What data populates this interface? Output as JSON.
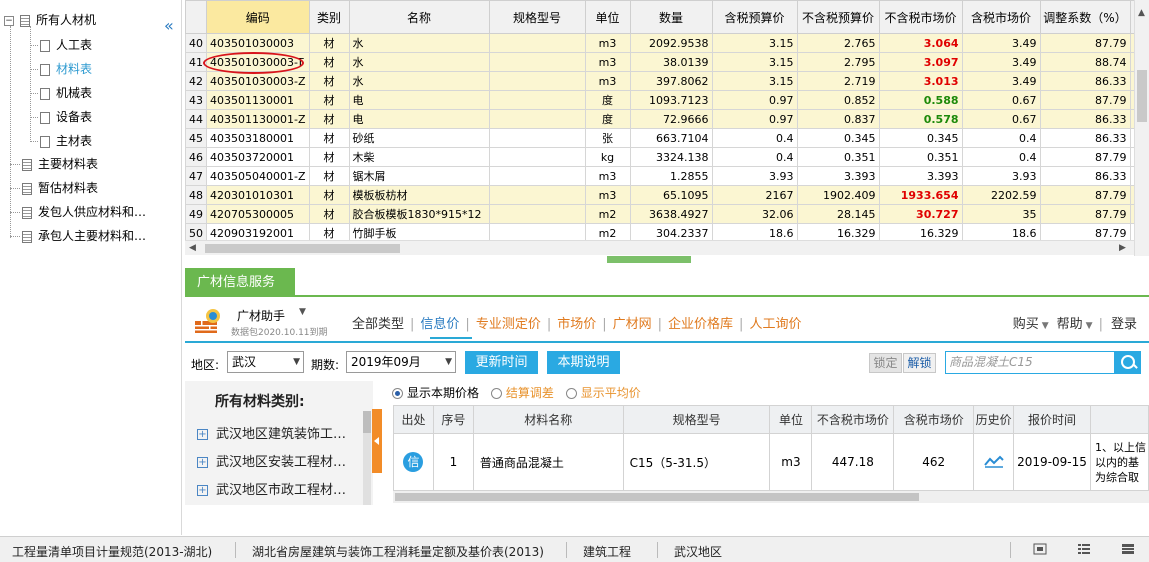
{
  "sidebar": {
    "collapse_icon": "«",
    "root_label": "所有人材机",
    "children": [
      "人工表",
      "材料表",
      "机械表",
      "设备表",
      "主材表"
    ],
    "selected": "材料表",
    "others": [
      "主要材料表",
      "暂估材料表",
      "发包人供应材料和…",
      "承包人主要材料和…"
    ]
  },
  "grid": {
    "columns": [
      "",
      "编码",
      "类别",
      "名称",
      "规格型号",
      "单位",
      "数量",
      "含税预算价",
      "不含税预算价",
      "不含税市场价",
      "含税市场价",
      "调整系数（%）"
    ],
    "rows": [
      {
        "no": "40",
        "code": "403501030003",
        "cat": "材",
        "name": "水",
        "spec": "",
        "unit": "m3",
        "qty": "2092.9538",
        "tax_budget": "3.15",
        "notax_budget": "2.765",
        "notax_market": "3.064",
        "market_style": "red",
        "tax_market": "3.49",
        "adj": "87.79",
        "hl": true
      },
      {
        "no": "41",
        "code": "403501030003-T",
        "cat": "材",
        "name": "水",
        "spec": "",
        "unit": "m3",
        "qty": "38.0139",
        "tax_budget": "3.15",
        "notax_budget": "2.795",
        "notax_market": "3.097",
        "market_style": "red",
        "tax_market": "3.49",
        "adj": "88.74",
        "hl": true
      },
      {
        "no": "42",
        "code": "403501030003-Z",
        "cat": "材",
        "name": "水",
        "spec": "",
        "unit": "m3",
        "qty": "397.8062",
        "tax_budget": "3.15",
        "notax_budget": "2.719",
        "notax_market": "3.013",
        "market_style": "red",
        "tax_market": "3.49",
        "adj": "86.33",
        "hl": true
      },
      {
        "no": "43",
        "code": "403501130001",
        "cat": "材",
        "name": "电",
        "spec": "",
        "unit": "度",
        "qty": "1093.7123",
        "tax_budget": "0.97",
        "notax_budget": "0.852",
        "notax_market": "0.588",
        "market_style": "green",
        "tax_market": "0.67",
        "adj": "87.79",
        "hl": true
      },
      {
        "no": "44",
        "code": "403501130001-Z",
        "cat": "材",
        "name": "电",
        "spec": "",
        "unit": "度",
        "qty": "72.9666",
        "tax_budget": "0.97",
        "notax_budget": "0.837",
        "notax_market": "0.578",
        "market_style": "green",
        "tax_market": "0.67",
        "adj": "86.33",
        "hl": true
      },
      {
        "no": "45",
        "code": "403503180001",
        "cat": "材",
        "name": "砂纸",
        "spec": "",
        "unit": "张",
        "qty": "663.7104",
        "tax_budget": "0.4",
        "notax_budget": "0.345",
        "notax_market": "0.345",
        "market_style": "",
        "tax_market": "0.4",
        "adj": "86.33",
        "hl": false
      },
      {
        "no": "46",
        "code": "403503720001",
        "cat": "材",
        "name": "木柴",
        "spec": "",
        "unit": "kg",
        "qty": "3324.138",
        "tax_budget": "0.4",
        "notax_budget": "0.351",
        "notax_market": "0.351",
        "market_style": "",
        "tax_market": "0.4",
        "adj": "87.79",
        "hl": false
      },
      {
        "no": "47",
        "code": "403505040001-Z",
        "cat": "材",
        "name": "锯木屑",
        "spec": "",
        "unit": "m3",
        "qty": "1.2855",
        "tax_budget": "3.93",
        "notax_budget": "3.393",
        "notax_market": "3.393",
        "market_style": "",
        "tax_market": "3.93",
        "adj": "86.33",
        "hl": false
      },
      {
        "no": "48",
        "code": "420301010301",
        "cat": "材",
        "name": "模板板枋材",
        "spec": "",
        "unit": "m3",
        "qty": "65.1095",
        "tax_budget": "2167",
        "notax_budget": "1902.409",
        "notax_market": "1933.654",
        "market_style": "red",
        "tax_market": "2202.59",
        "adj": "87.79",
        "hl": true
      },
      {
        "no": "49",
        "code": "420705300005",
        "cat": "材",
        "name": "胶合板模板1830*915*12",
        "spec": "",
        "unit": "m2",
        "qty": "3638.4927",
        "tax_budget": "32.06",
        "notax_budget": "28.145",
        "notax_market": "30.727",
        "market_style": "red",
        "tax_market": "35",
        "adj": "87.79",
        "hl": true
      },
      {
        "no": "50",
        "code": "420903192001",
        "cat": "材",
        "name": "竹脚手板",
        "spec": "",
        "unit": "m2",
        "qty": "304.2337",
        "tax_budget": "18.6",
        "notax_budget": "16.329",
        "notax_market": "16.329",
        "market_style": "",
        "tax_market": "18.6",
        "adj": "87.79",
        "hl": false
      }
    ]
  },
  "info_service": {
    "tab_label": "广材信息服务",
    "brand": "广材助手",
    "brand_sub": "数据包2020.10.11到期",
    "nav": [
      "全部类型",
      "信息价",
      "专业测定价",
      "市场价",
      "广材网",
      "企业价格库",
      "人工询价"
    ],
    "nav_active": "信息价",
    "right_nav": [
      "购买",
      "帮助",
      "登录"
    ],
    "region_label": "地区:",
    "region_value": "武汉",
    "period_label": "期数:",
    "period_value": "2019年09月",
    "btn_update": "更新时间",
    "btn_note": "本期说明",
    "btn_lock": "锁定",
    "btn_unlock": "解锁",
    "search_placeholder": "商品混凝土C15",
    "category_title": "所有材料类别:",
    "categories": [
      "武汉地区建筑装饰工…",
      "武汉地区安装工程材…",
      "武汉地区市政工程材…"
    ],
    "radio_options": [
      "显示本期价格",
      "结算调差",
      "显示平均价"
    ],
    "price_columns": [
      "出处",
      "序号",
      "材料名称",
      "规格型号",
      "单位",
      "不含税市场价",
      "含税市场价",
      "历史价",
      "报价时间",
      ""
    ],
    "price_rows": [
      {
        "source": "信",
        "no": "1",
        "name": "普通商品混凝土",
        "spec": "C15（5-31.5）",
        "unit": "m3",
        "notax": "447.18",
        "tax": "462",
        "date": "2019-09-15",
        "note": "1、以上信\n以内的基\n为综合取"
      }
    ]
  },
  "statusbar": {
    "items": [
      "工程量清单项目计量规范(2013-湖北)",
      "湖北省房屋建筑与装饰工程消耗量定额及基价表(2013)",
      "建筑工程",
      "武汉地区"
    ]
  },
  "colors": {
    "accent_green": "#6bb84f",
    "accent_blue": "#2aa9e2",
    "highlight_row": "#fbf6d2",
    "red_price": "#e00000",
    "green_price": "#1d8a0a",
    "annotation_red": "#d8141b"
  }
}
